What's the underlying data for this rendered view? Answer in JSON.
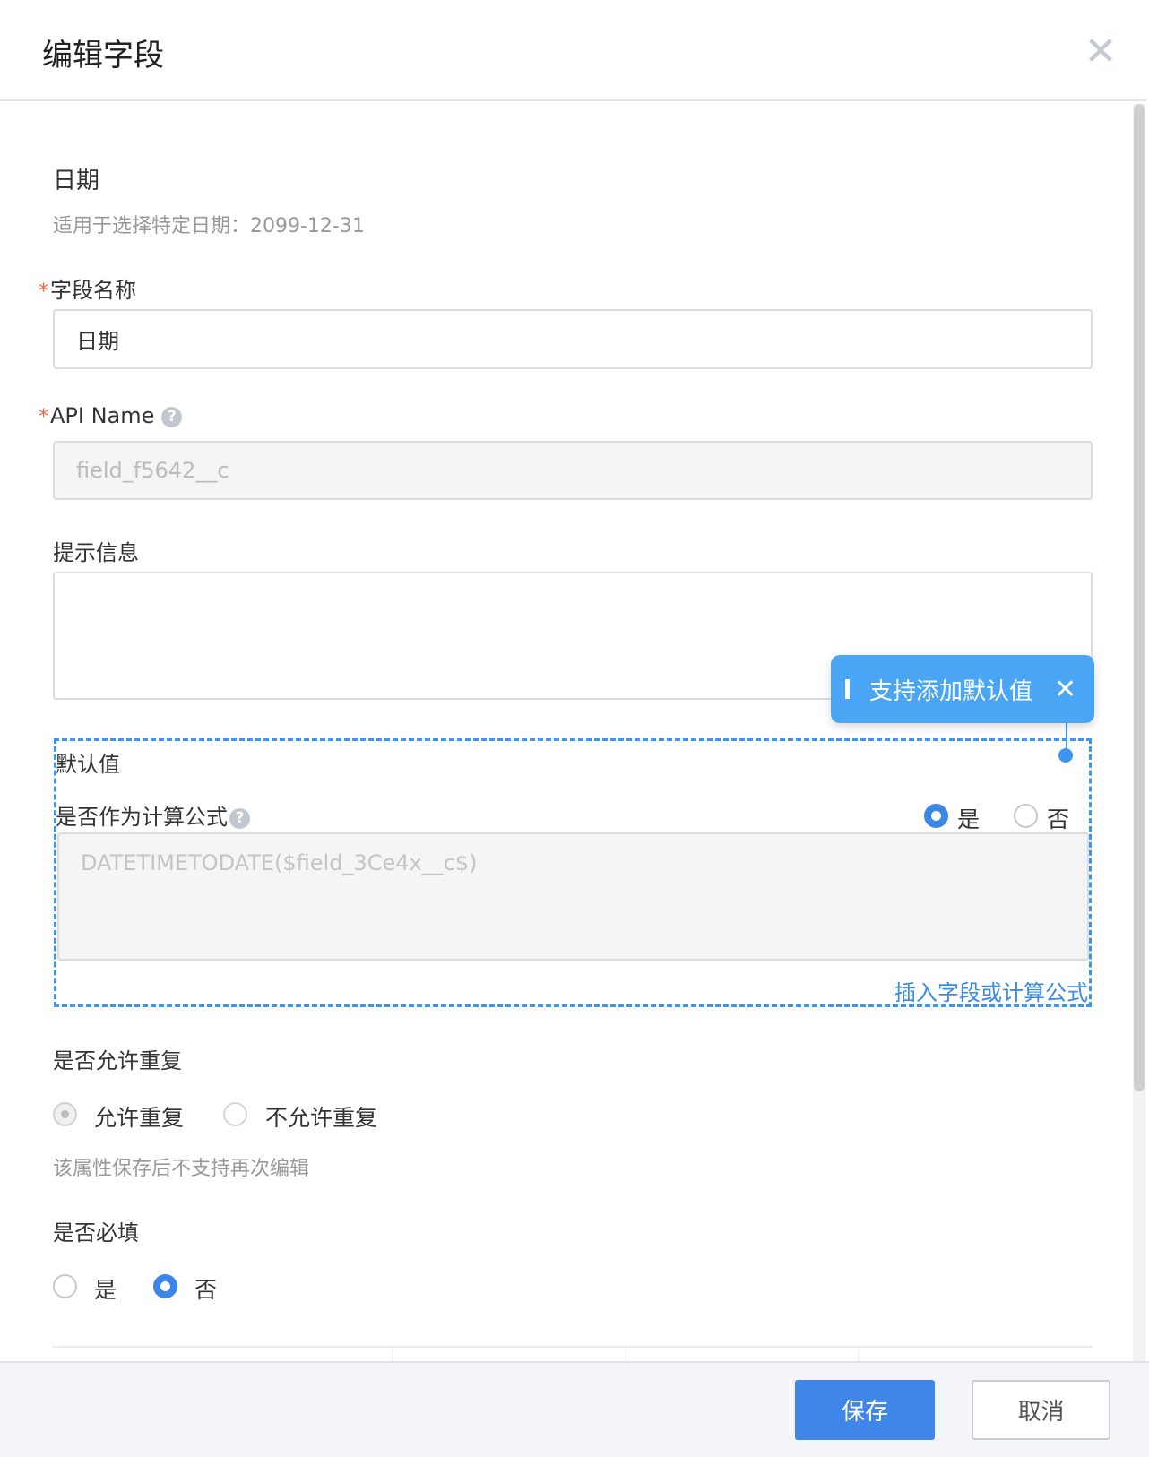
{
  "dialog": {
    "title": "编辑字段",
    "close_icon": "close-icon"
  },
  "field_type": {
    "name": "日期",
    "description": "适用于选择特定日期：2099-12-31"
  },
  "field_name": {
    "label": "字段名称",
    "value": "日期",
    "required": true
  },
  "api_name": {
    "label": "API Name",
    "value": "field_f5642__c",
    "required": true
  },
  "hint": {
    "label": "提示信息",
    "value": ""
  },
  "tooltip": {
    "text": "支持添加默认值",
    "color": "#4aa6f4"
  },
  "default_value": {
    "label": "默认值",
    "formula_label": "是否作为计算公式",
    "yes": "是",
    "no": "否",
    "selected": "是",
    "formula": "DATETIMETODATE($field_3Ce4x__c$)",
    "insert_link": "插入字段或计算公式"
  },
  "duplicate": {
    "label": "是否允许重复",
    "options": [
      "允许重复",
      "不允许重复"
    ],
    "selected": "允许重复",
    "note": "该属性保存后不支持再次编辑"
  },
  "required": {
    "label": "是否必填",
    "options": [
      "是",
      "否"
    ],
    "selected": "否"
  },
  "footer": {
    "save": "保存",
    "cancel": "取消",
    "accent": "#3f86e8"
  }
}
